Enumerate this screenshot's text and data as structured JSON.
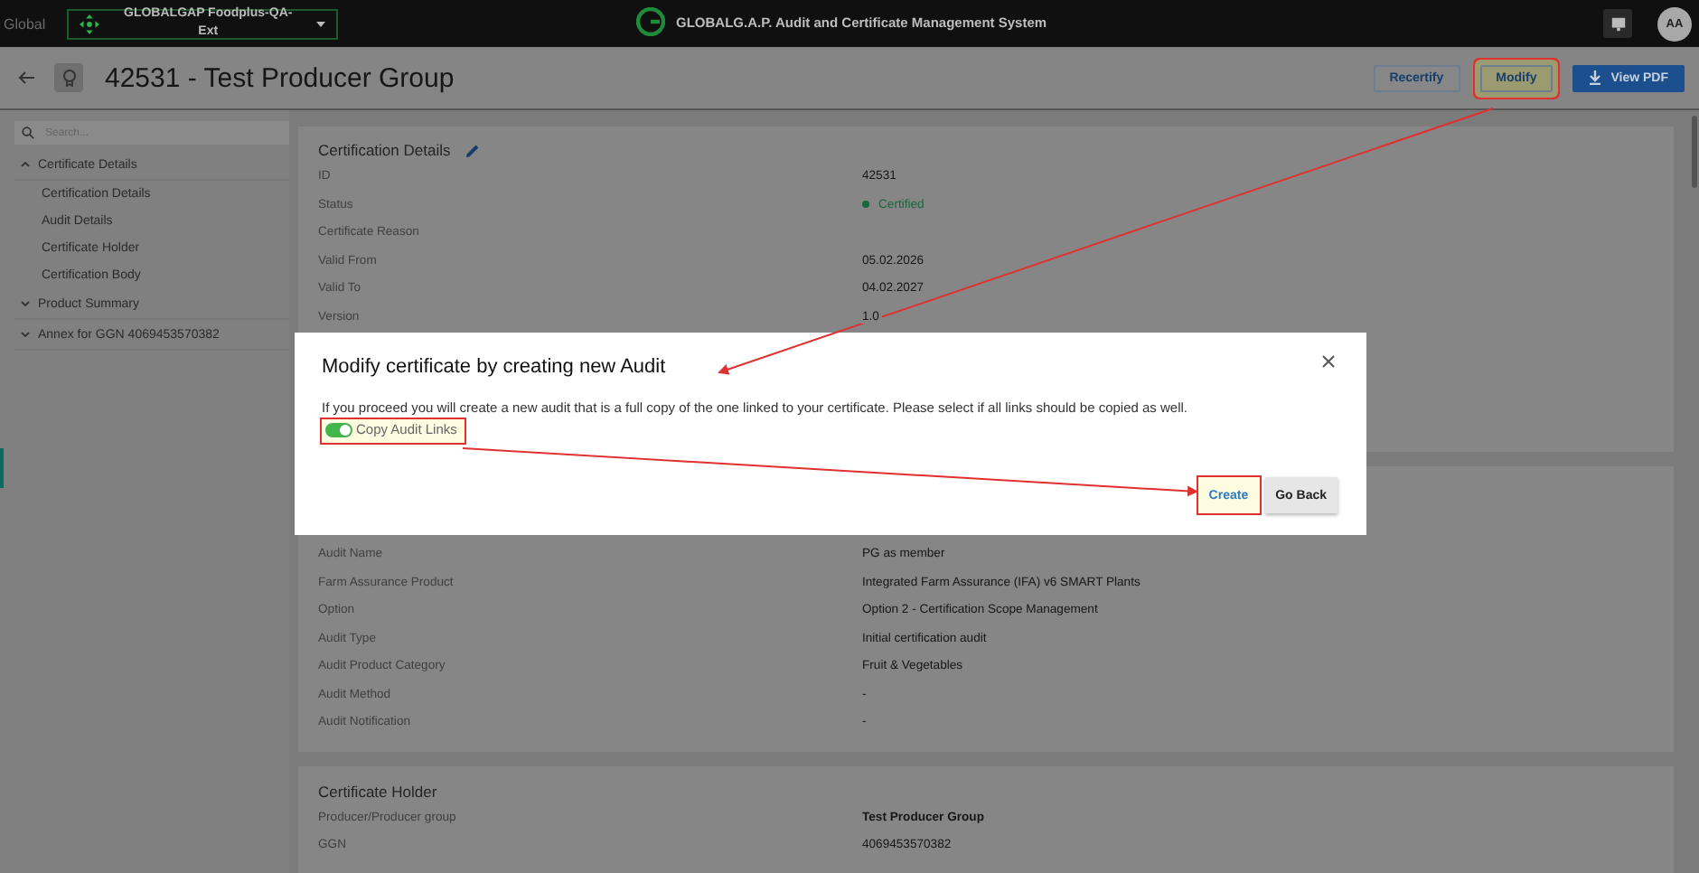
{
  "top_bar": {
    "scope": "Global",
    "tenant": {
      "label": "GLOBALGAP Foodplus-QA-Ext"
    },
    "app_title": "GLOBALG.A.P. Audit and Certificate Management System",
    "avatar": "AA"
  },
  "header": {
    "title": "42531 - Test Producer Group",
    "buttons": [
      {
        "label": "Recertify",
        "kind": "outline",
        "highlighted": false
      },
      {
        "label": "Modify",
        "kind": "outline",
        "highlighted": true
      },
      {
        "label": "View PDF",
        "kind": "primary",
        "highlighted": false
      }
    ]
  },
  "sidebar": {
    "search": {
      "placeholder": "Search..."
    },
    "items": [
      {
        "label": "Certificate Details",
        "expanded": true,
        "children": [
          {
            "label": "Certification Details"
          },
          {
            "label": "Audit Details"
          },
          {
            "label": "Certificate Holder"
          },
          {
            "label": "Certification Body"
          }
        ]
      },
      {
        "label": "Product Summary",
        "expanded": false
      },
      {
        "label": "Annex for GGN 4069453570382",
        "expanded": false
      }
    ]
  },
  "sections": [
    {
      "title": "Certification Details",
      "editable": true,
      "fields": [
        {
          "label": "ID",
          "value": "42531",
          "kind": "text"
        },
        {
          "label": "Status",
          "value": "Certified",
          "kind": "status",
          "color": "#16683a"
        },
        {
          "label": "Certificate Reason"
        },
        {
          "label": "Valid From",
          "value": "05.02.2026",
          "kind": "text"
        },
        {
          "label": "Valid To",
          "value": "04.02.2027",
          "kind": "text"
        },
        {
          "label": "Version",
          "value": "1.0",
          "kind": "text"
        }
      ]
    },
    {
      "fields": [
        {
          "label": "Audit Name",
          "value": "PG as member",
          "kind": "text"
        },
        {
          "label": "Farm Assurance Product",
          "value": "Integrated Farm Assurance (IFA) v6 SMART Plants",
          "kind": "text"
        },
        {
          "label": "Option",
          "value": "Option 2 - Certification Scope Management",
          "kind": "text"
        },
        {
          "label": "Audit Type",
          "value": "Initial certification audit",
          "kind": "text"
        },
        {
          "label": "Audit Product Category",
          "value": "Fruit & Vegetables",
          "kind": "text"
        },
        {
          "label": "Audit Method",
          "value": "-",
          "kind": "text"
        },
        {
          "label": "Audit Notification",
          "value": "-",
          "kind": "text"
        }
      ]
    },
    {
      "title": "Certificate Holder",
      "fields": [
        {
          "label": "Producer/Producer group",
          "value": "Test Producer Group",
          "kind": "bold"
        },
        {
          "label": "GGN",
          "value": "4069453570382",
          "kind": "text"
        }
      ]
    }
  ],
  "dialog": {
    "title": "Modify certificate by creating new Audit",
    "message": "If you proceed you will create a new audit that is a full copy of the one linked to your certificate. Please select if all links should be copied as well.",
    "toggle": {
      "label": "Copy Audit Links",
      "on": true,
      "highlighted": true
    },
    "buttons": [
      {
        "label": "Create",
        "kind": "text",
        "highlighted": true
      },
      {
        "label": "Go Back",
        "kind": "secondary",
        "highlighted": false
      }
    ]
  }
}
